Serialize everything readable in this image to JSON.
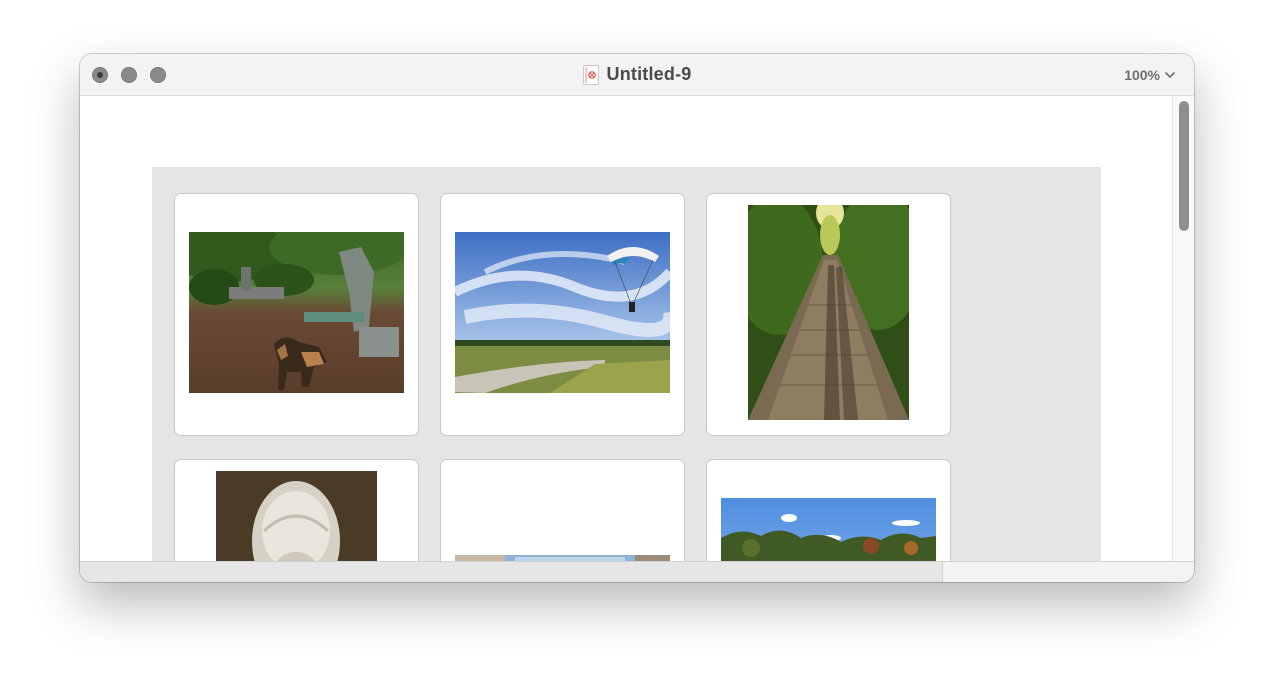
{
  "window": {
    "title": "Untitled-9",
    "zoom_label": "100%",
    "icons": {
      "close": "close-dot-icon",
      "minimize": "minimize-dot-icon",
      "maximize": "maximize-dot-icon",
      "document": "pages-document-icon",
      "zoom_menu": "chevron-down-icon"
    }
  },
  "photos": [
    {
      "subject": "dog-statue-garden",
      "accent": "#6b8e3a"
    },
    {
      "subject": "paraglider-sky",
      "accent": "#5b8fd6"
    },
    {
      "subject": "boardwalk-forest",
      "accent": "#4f7a2b"
    },
    {
      "subject": "veiled-marble-bust",
      "accent": "#d9d4c9"
    },
    {
      "subject": "street-scene",
      "accent": "#7d9fbf"
    },
    {
      "subject": "treeline-sky",
      "accent": "#6ea1e6"
    }
  ]
}
